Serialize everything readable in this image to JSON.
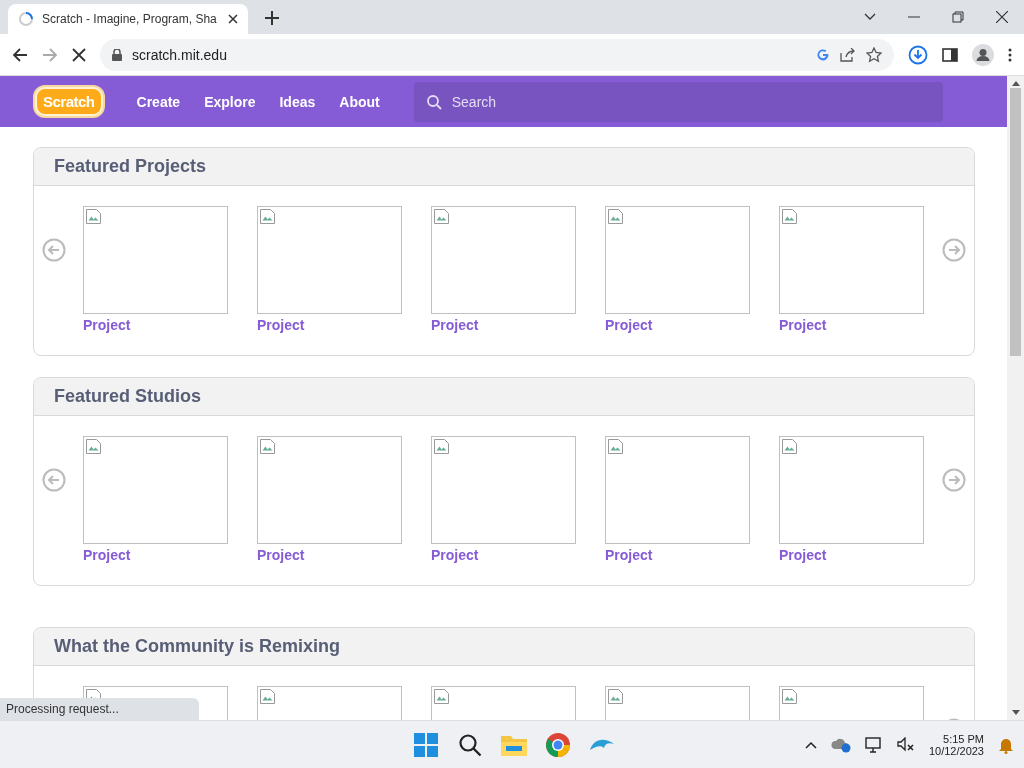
{
  "browser": {
    "tab_title": "Scratch - Imagine, Program, Sha",
    "url": "scratch.mit.edu"
  },
  "nav": {
    "logo": "Scratch",
    "links": [
      "Create",
      "Explore",
      "Ideas",
      "About"
    ],
    "search_placeholder": "Search"
  },
  "sections": [
    {
      "title": "Featured Projects",
      "labels": [
        "Project",
        "Project",
        "Project",
        "Project",
        "Project"
      ]
    },
    {
      "title": "Featured Studios",
      "labels": [
        "Project",
        "Project",
        "Project",
        "Project",
        "Project"
      ]
    },
    {
      "title": "What the Community is Remixing"
    }
  ],
  "status": "Processing request...",
  "taskbar": {
    "time": "5:15 PM",
    "date": "10/12/2023"
  }
}
